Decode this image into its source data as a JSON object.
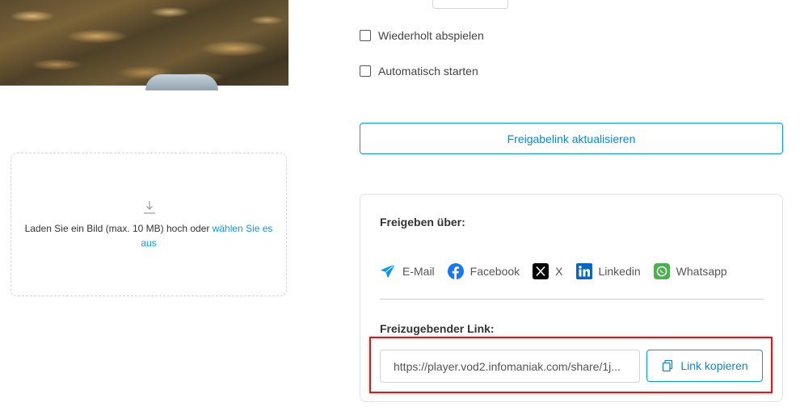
{
  "thumbnail": {
    "alt": "",
    "icon": "video-thumbnail"
  },
  "upload": {
    "icon": "download-arrow-icon",
    "text": "Laden Sie ein Bild (max. 10 MB) hoch oder ",
    "link": "wählen Sie es aus"
  },
  "options": {
    "loop_label": "Wiederholt abspielen",
    "loop_checked": false,
    "autoplay_label": "Automatisch starten",
    "autoplay_checked": false
  },
  "refresh_button": "Freigabelink aktualisieren",
  "share": {
    "title": "Freigeben über:",
    "channels": [
      {
        "label": "E-Mail",
        "icon": "paper-plane-icon",
        "color": "#0098ff"
      },
      {
        "label": "Facebook",
        "icon": "facebook-icon",
        "color": "#1877f2"
      },
      {
        "label": "X",
        "icon": "x-icon",
        "color": "#000000"
      },
      {
        "label": "Linkedin",
        "icon": "linkedin-icon",
        "color": "#0a66c2"
      },
      {
        "label": "Whatsapp",
        "icon": "whatsapp-icon",
        "color": "#4caf50"
      }
    ],
    "link_title": "Freizugebender Link:",
    "link_value": "https://player.vod2.infomaniak.com/share/1j...",
    "copy_button": "Link kopieren",
    "copy_icon": "copy-icon"
  },
  "colors": {
    "accent": "#0098ff",
    "highlight": "#d81b1b"
  }
}
